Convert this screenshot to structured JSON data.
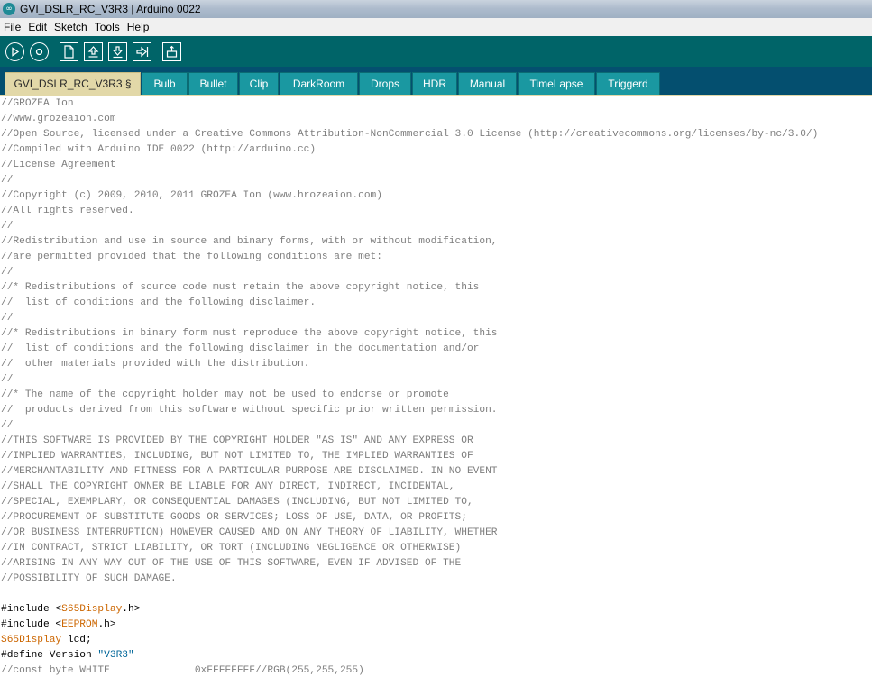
{
  "window": {
    "title": "GVI_DSLR_RC_V3R3 | Arduino 0022",
    "icon": "arduino-icon"
  },
  "menubar": {
    "items": [
      "File",
      "Edit",
      "Sketch",
      "Tools",
      "Help"
    ]
  },
  "toolbar": {
    "buttons": [
      {
        "name": "verify-button",
        "icon": "play-icon"
      },
      {
        "name": "stop-button",
        "icon": "stop-icon"
      },
      {
        "name": "new-button",
        "icon": "new-file-icon"
      },
      {
        "name": "open-button",
        "icon": "open-arrow-up-icon"
      },
      {
        "name": "save-button",
        "icon": "save-arrow-down-icon"
      },
      {
        "name": "upload-button",
        "icon": "upload-arrow-right-icon"
      },
      {
        "name": "serial-monitor-button",
        "icon": "serial-monitor-icon"
      }
    ]
  },
  "tabs": [
    {
      "label": "GVI_DSLR_RC_V3R3 §",
      "active": true
    },
    {
      "label": "Bulb"
    },
    {
      "label": "Bullet"
    },
    {
      "label": "Clip"
    },
    {
      "label": "DarkRoom"
    },
    {
      "label": "Drops"
    },
    {
      "label": "HDR"
    },
    {
      "label": "Manual"
    },
    {
      "label": "TimeLapse"
    },
    {
      "label": "Triggerd"
    }
  ],
  "editor": {
    "comment_lines": [
      "//GROZEA Ion",
      "//www.grozeaion.com",
      "//Open Source, licensed under a Creative Commons Attribution-NonCommercial 3.0 License (http://creativecommons.org/licenses/by-nc/3.0/)",
      "//Compiled with Arduino IDE 0022 (http://arduino.cc)",
      "//License Agreement",
      "//",
      "//Copyright (c) 2009, 2010, 2011 GROZEA Ion (www.hrozeaion.com)",
      "//All rights reserved.",
      "//",
      "//Redistribution and use in source and binary forms, with or without modification,",
      "//are permitted provided that the following conditions are met:",
      "//",
      "//* Redistributions of source code must retain the above copyright notice, this",
      "//  list of conditions and the following disclaimer.",
      "//",
      "//* Redistributions in binary form must reproduce the above copyright notice, this",
      "//  list of conditions and the following disclaimer in the documentation and/or",
      "//  other materials provided with the distribution.",
      "//",
      "//* The name of the copyright holder may not be used to endorse or promote",
      "//  products derived from this software without specific prior written permission.",
      "//",
      "//THIS SOFTWARE IS PROVIDED BY THE COPYRIGHT HOLDER \"AS IS\" AND ANY EXPRESS OR",
      "//IMPLIED WARRANTIES, INCLUDING, BUT NOT LIMITED TO, THE IMPLIED WARRANTIES OF",
      "//MERCHANTABILITY AND FITNESS FOR A PARTICULAR PURPOSE ARE DISCLAIMED. IN NO EVENT",
      "//SHALL THE COPYRIGHT OWNER BE LIABLE FOR ANY DIRECT, INDIRECT, INCIDENTAL,",
      "//SPECIAL, EXEMPLARY, OR CONSEQUENTIAL DAMAGES (INCLUDING, BUT NOT LIMITED TO,",
      "//PROCUREMENT OF SUBSTITUTE GOODS OR SERVICES; LOSS OF USE, DATA, OR PROFITS;",
      "//OR BUSINESS INTERRUPTION) HOWEVER CAUSED AND ON ANY THEORY OF LIABILITY, WHETHER",
      "//IN CONTRACT, STRICT LIABILITY, OR TORT (INCLUDING NEGLIGENCE OR OTHERWISE)",
      "//ARISING IN ANY WAY OUT OF THE USE OF THIS SOFTWARE, EVEN IF ADVISED OF THE",
      "//POSSIBILITY OF SUCH DAMAGE."
    ],
    "code_lines": [
      {
        "prefix": "#include <",
        "token": "S65Display",
        "token_kind": "kw",
        "suffix": ".h>"
      },
      {
        "prefix": "#include <",
        "token": "EEPROM",
        "token_kind": "kw",
        "suffix": ".h>"
      },
      {
        "prefix": "",
        "token": "S65Display",
        "token_kind": "kw",
        "suffix": " lcd;"
      },
      {
        "prefix": "#define Version ",
        "token": "\"V3R3\"",
        "token_kind": "str",
        "suffix": ""
      }
    ],
    "last_line": "//const byte WHITE              0xFFFFFFFF//RGB(255,255,255)"
  },
  "colors": {
    "toolbar_bg": "#006468",
    "tab_strip_bg": "#044f6f",
    "tab_bg": "#1a98a1",
    "active_tab_bg": "#e2d8a8",
    "comment_text": "#7e7e7e",
    "keyword": "#cc6600",
    "string": "#006699"
  }
}
